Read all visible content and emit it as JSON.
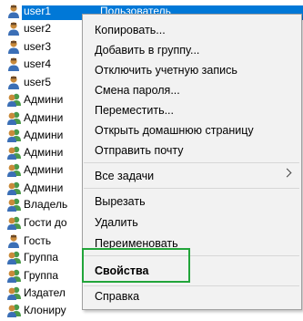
{
  "list": {
    "rows": [
      {
        "name": "user1",
        "type": "Пользователь",
        "icon": "user-icon",
        "selected": true
      },
      {
        "name": "user2",
        "icon": "user-icon"
      },
      {
        "name": "user3",
        "icon": "user-icon"
      },
      {
        "name": "user4",
        "icon": "user-icon"
      },
      {
        "name": "user5",
        "icon": "user-icon"
      },
      {
        "name": "Админи",
        "icon": "group-icon"
      },
      {
        "name": "Админи",
        "icon": "group-icon"
      },
      {
        "name": "Админи",
        "icon": "group-icon"
      },
      {
        "name": "Админи",
        "icon": "group-icon"
      },
      {
        "name": "Админи",
        "icon": "group-icon"
      },
      {
        "name": "Админи",
        "icon": "group-icon"
      },
      {
        "name": "Владель",
        "icon": "group-icon"
      },
      {
        "name": "Гости до",
        "icon": "group-icon"
      },
      {
        "name": "Гость",
        "icon": "user-icon"
      },
      {
        "name": "Группа",
        "icon": "group-icon"
      },
      {
        "name": "Группа",
        "icon": "group-icon"
      },
      {
        "name": "Издател",
        "icon": "group-icon"
      },
      {
        "name": "Клониру",
        "icon": "group-icon"
      }
    ]
  },
  "context_menu": {
    "copy": "Копировать...",
    "add_to_group": "Добавить в группу...",
    "disable_account": "Отключить учетную запись",
    "reset_password": "Смена пароля...",
    "move": "Переместить...",
    "open_home_page": "Открыть домашнюю страницу",
    "send_mail": "Отправить почту",
    "all_tasks": "Все задачи",
    "cut": "Вырезать",
    "delete": "Удалить",
    "rename": "Переименовать",
    "properties": "Свойства",
    "help": "Справка"
  },
  "colors": {
    "selection": "#0078d7",
    "highlight_border": "#22a53a",
    "menu_bg": "#f2f2f2"
  }
}
